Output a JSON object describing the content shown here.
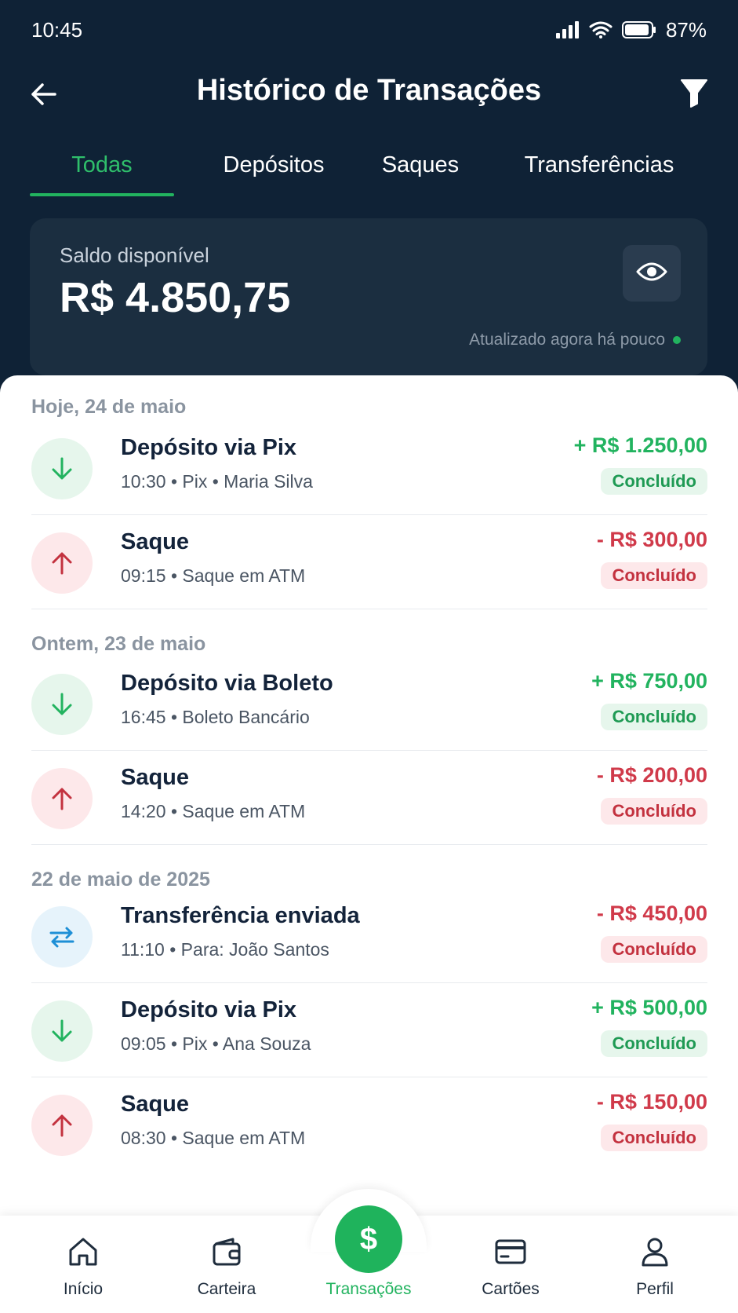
{
  "status_bar": {
    "time": "10:45",
    "battery": "87%"
  },
  "header": {
    "title": "Histórico de Transações"
  },
  "tabs": [
    {
      "label": "Todas",
      "active": true
    },
    {
      "label": "Depósitos",
      "active": false
    },
    {
      "label": "Saques",
      "active": false
    },
    {
      "label": "Transferências",
      "active": false
    }
  ],
  "balance": {
    "label": "Saldo disponível",
    "value": "R$ 4.850,75",
    "updated": "Atualizado agora há pouco"
  },
  "sections": [
    {
      "title": "Hoje, 24 de maio",
      "transactions": [
        {
          "type": "in",
          "icon": "arrow-down-icon",
          "title": "Depósito via Pix",
          "subtitle": "10:30 • Pix • Maria Silva",
          "amount": "+ R$ 1.250,00",
          "status": "Concluído"
        },
        {
          "type": "out",
          "icon": "arrow-up-icon",
          "title": "Saque",
          "subtitle": "09:15 • Saque em ATM",
          "amount": "- R$ 300,00",
          "status": "Concluído"
        }
      ]
    },
    {
      "title": "Ontem, 23 de maio",
      "transactions": [
        {
          "type": "in",
          "icon": "arrow-down-icon",
          "title": "Depósito via Boleto",
          "subtitle": "16:45 • Boleto Bancário",
          "amount": "+ R$ 750,00",
          "status": "Concluído"
        },
        {
          "type": "out",
          "icon": "arrow-up-icon",
          "title": "Saque",
          "subtitle": "14:20 • Saque em ATM",
          "amount": "- R$ 200,00",
          "status": "Concluído"
        }
      ]
    },
    {
      "title": "22 de maio de 2025",
      "transactions": [
        {
          "type": "transfer",
          "icon": "transfer-arrows-icon",
          "title": "Transferência enviada",
          "subtitle": "11:10 • Para: João Santos",
          "amount": "- R$ 450,00",
          "status": "Concluído"
        },
        {
          "type": "in",
          "icon": "arrow-down-icon",
          "title": "Depósito via Pix",
          "subtitle": "09:05 • Pix • Ana Souza",
          "amount": "+ R$ 500,00",
          "status": "Concluído"
        },
        {
          "type": "out",
          "icon": "arrow-up-icon",
          "title": "Saque",
          "subtitle": "08:30 • Saque em ATM",
          "amount": "- R$ 150,00",
          "status": "Concluído"
        }
      ]
    }
  ],
  "bottom_nav": [
    {
      "label": "Início",
      "icon": "home-icon",
      "active": false
    },
    {
      "label": "Carteira",
      "icon": "wallet-icon",
      "active": false
    },
    {
      "label": "Transações",
      "icon": "dollar-icon",
      "active": true
    },
    {
      "label": "Cartões",
      "icon": "card-icon",
      "active": false
    },
    {
      "label": "Perfil",
      "icon": "user-icon",
      "active": false
    }
  ],
  "fab_symbol": "$",
  "colors": {
    "header_bg": "#0f2236",
    "accent_green": "#22b35f",
    "negative_red": "#d03a4a",
    "transfer_blue": "#1e8fd6"
  }
}
